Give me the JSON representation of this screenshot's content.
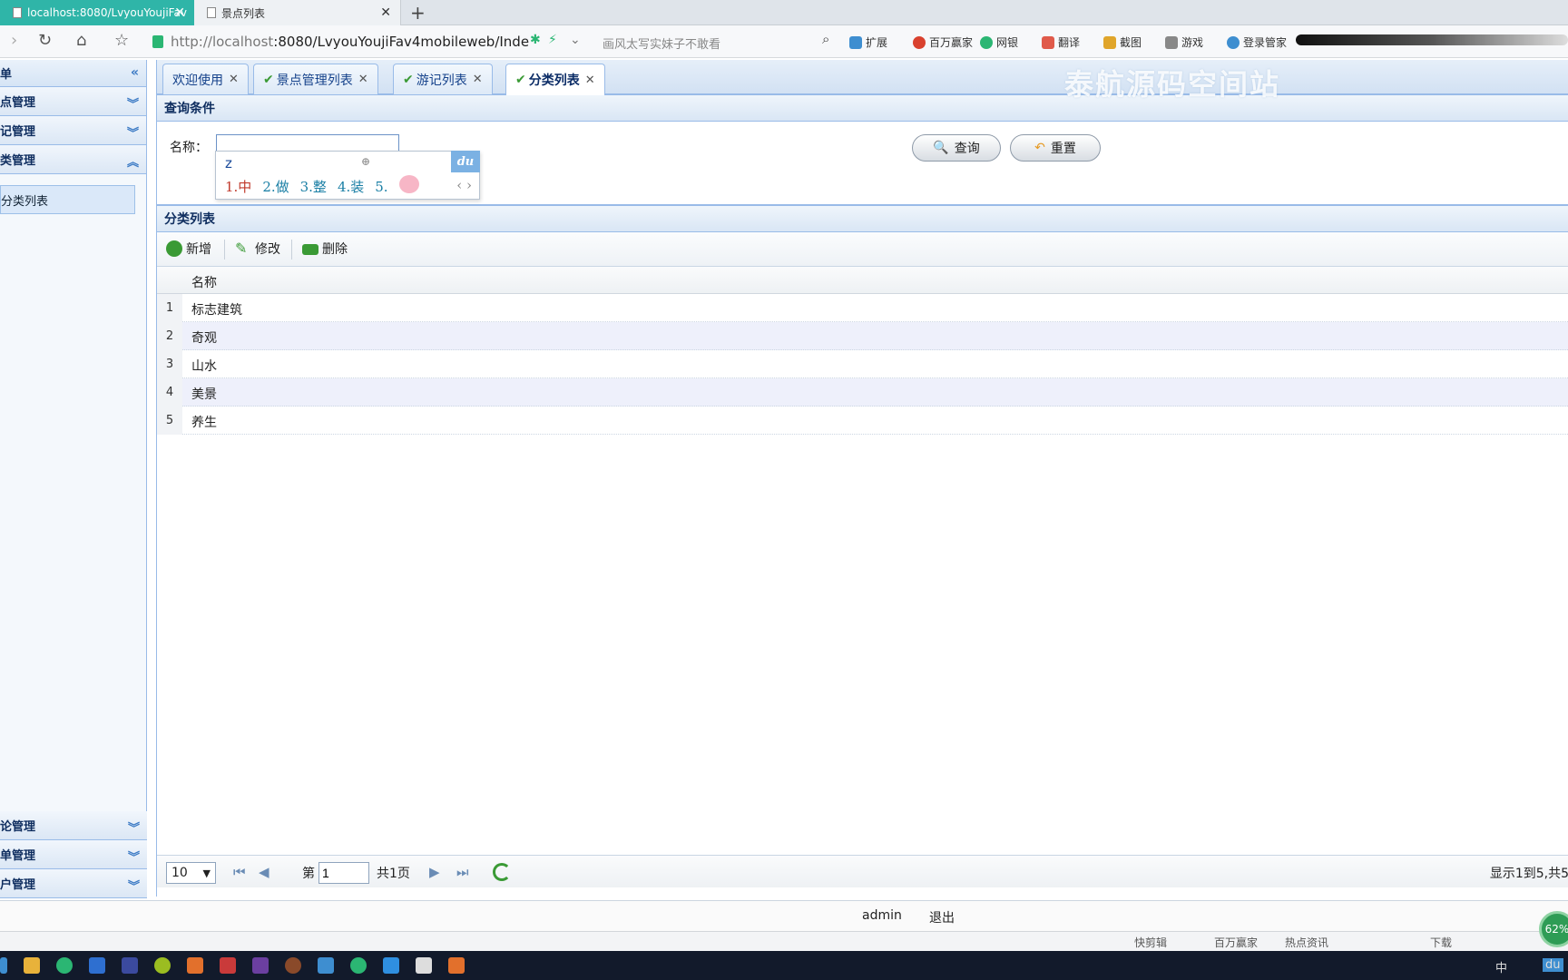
{
  "browser": {
    "tabs": [
      {
        "label": "localhost:8080/LvyouYoujiFav",
        "active": true
      },
      {
        "label": "景点列表",
        "active": false
      }
    ],
    "new_tab": "+",
    "url_host": "http://localhost",
    "url_rest": ":8080/LvyouYoujiFav4mobileweb/Inde",
    "search_placeholder": "画风太写实妹子不敢看",
    "extensions": [
      "扩展",
      "百万赢家",
      "网银",
      "翻译",
      "截图",
      "游戏",
      "登录管家"
    ]
  },
  "sidebar": {
    "header": "单",
    "sections_top": [
      {
        "label": "点管理",
        "expanded": false
      },
      {
        "label": "记管理",
        "expanded": false
      },
      {
        "label": "类管理",
        "expanded": true
      }
    ],
    "sub_items": [
      "分类列表"
    ],
    "sections_bottom": [
      {
        "label": "论管理"
      },
      {
        "label": "单管理"
      },
      {
        "label": "户管理"
      }
    ]
  },
  "content_tabs": [
    {
      "label": "欢迎使用",
      "check": false
    },
    {
      "label": "景点管理列表",
      "check": true
    },
    {
      "label": "游记列表",
      "check": true
    },
    {
      "label": "分类列表",
      "check": true,
      "selected": true
    }
  ],
  "watermark": "泰航源码空间站",
  "query": {
    "title": "查询条件",
    "name_label": "名称：",
    "name_value": "",
    "search_button": "查询",
    "reset_button": "重置"
  },
  "ime": {
    "composition": "z",
    "candidates": [
      "1.中",
      "2.做",
      "3.整",
      "4.装",
      "5."
    ],
    "badge": "du"
  },
  "list": {
    "title": "分类列表",
    "toolbar": {
      "add": "新增",
      "edit": "修改",
      "delete": "删除"
    },
    "column_name": "名称",
    "rows": [
      {
        "no": "1",
        "name": "标志建筑"
      },
      {
        "no": "2",
        "name": "奇观"
      },
      {
        "no": "3",
        "name": "山水"
      },
      {
        "no": "4",
        "name": "美景"
      },
      {
        "no": "5",
        "name": "养生"
      }
    ]
  },
  "pager": {
    "page_size": "10",
    "page_prefix": "第",
    "page_value": "1",
    "total_pages": "共1页",
    "info": "显示1到5,共5"
  },
  "footer": {
    "user": "admin",
    "logout": "退出"
  },
  "statusbar": {
    "items": [
      "快剪辑",
      "百万赢家",
      "热点资讯",
      "下载"
    ],
    "badge": "62%"
  },
  "taskbar": {
    "tray_text": [
      "中",
      "du"
    ]
  },
  "colors": {
    "accent": "#2fb5a8",
    "border": "#99bbe8",
    "alt_row": "#eef0fb"
  }
}
